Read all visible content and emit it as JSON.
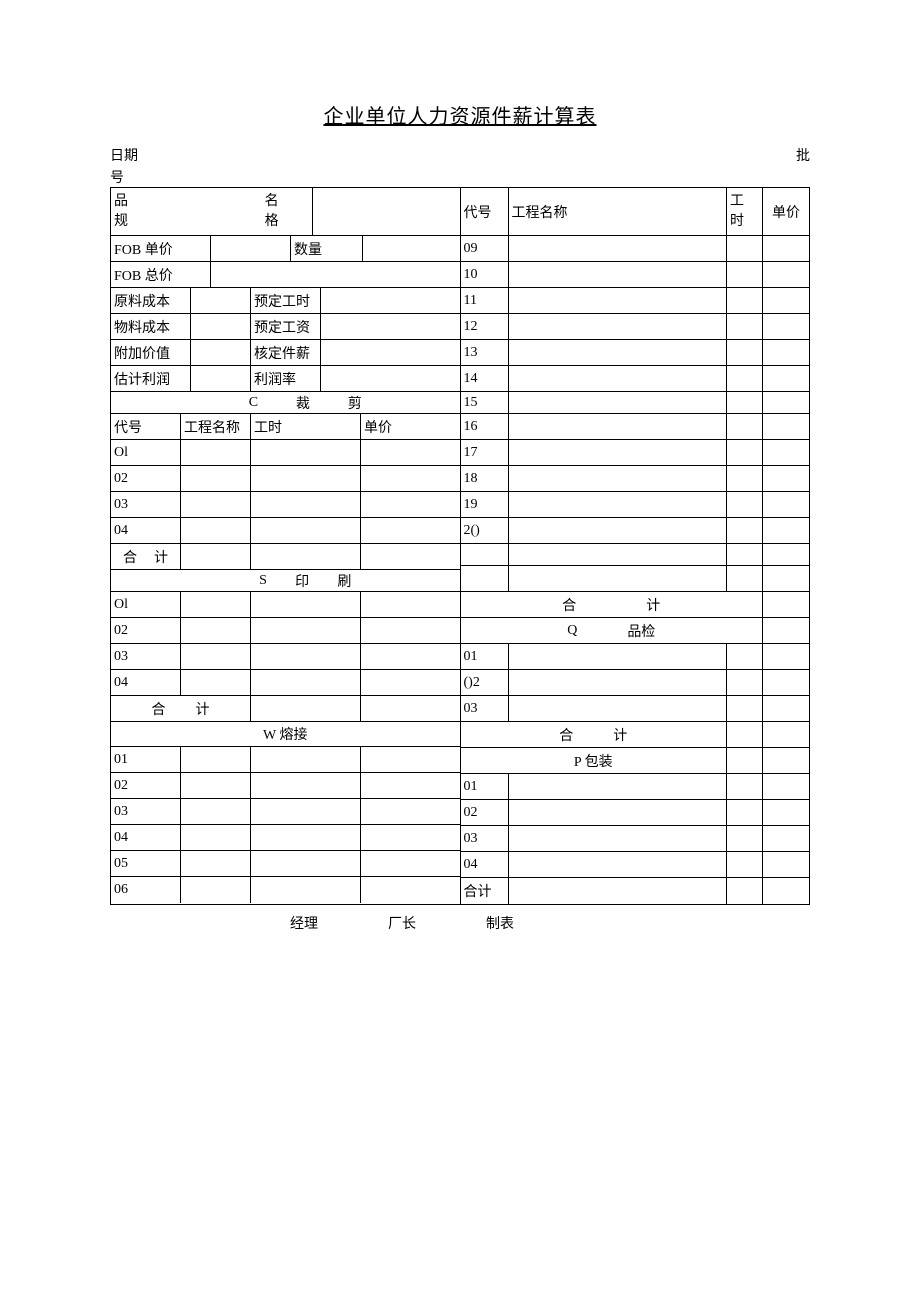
{
  "title": "企业单位人力资源件薪计算表",
  "meta": {
    "date": "日期",
    "batch": "批",
    "hao": "号"
  },
  "left": {
    "l1a": "品",
    "l1b": "名",
    "l2a": "规",
    "l2b": "格",
    "fob_price": "FOB 单价",
    "qty": "数量",
    "fob_total": "FOB 总价",
    "raw_cost": "原料成本",
    "plan_hours": "预定工时",
    "mat_cost": "物料成本",
    "plan_wage": "预定工资",
    "add_value": "附加价值",
    "approved_piece": "核定件薪",
    "est_profit": "估计利润",
    "profit_rate": "利润率",
    "sec_c": "C",
    "sec_c1": "裁",
    "sec_c2": "剪",
    "col_code": "代号",
    "col_proj": "工程名称",
    "col_hours": "工时",
    "col_price": "单价",
    "O1": "Ol",
    "02": "02",
    "03": "03",
    "04": "04",
    "subtotal_a": "合",
    "subtotal_b": "计",
    "sec_s": "S",
    "sec_s1": "印",
    "sec_s2": "刷",
    "sec_w_full": "W 熔接",
    "05": "05",
    "06": "06"
  },
  "right": {
    "col_code": "代号",
    "col_proj": "工程名称",
    "col_hours_a": "工",
    "col_hours_b": "时",
    "col_price": "单价",
    "09": "09",
    "10": "10",
    "11": "11",
    "12": "12",
    "13": "13",
    "14": "14",
    "15": "15",
    "16": "16",
    "17": "17",
    "18": "18",
    "19": "19",
    "20": "2()",
    "subtotal_a": "合",
    "subtotal_b": "计",
    "sec_q": "Q",
    "sec_q1": "品检",
    "01": "01",
    "O2": "()2",
    "03": "03",
    "sec_p_full": "P 包装",
    "p01": "01",
    "p02": "02",
    "p03": "03",
    "p04": "04",
    "p_total": "合计"
  },
  "footer": {
    "mgr": "经理",
    "dir": "厂长",
    "prep": "制表"
  }
}
